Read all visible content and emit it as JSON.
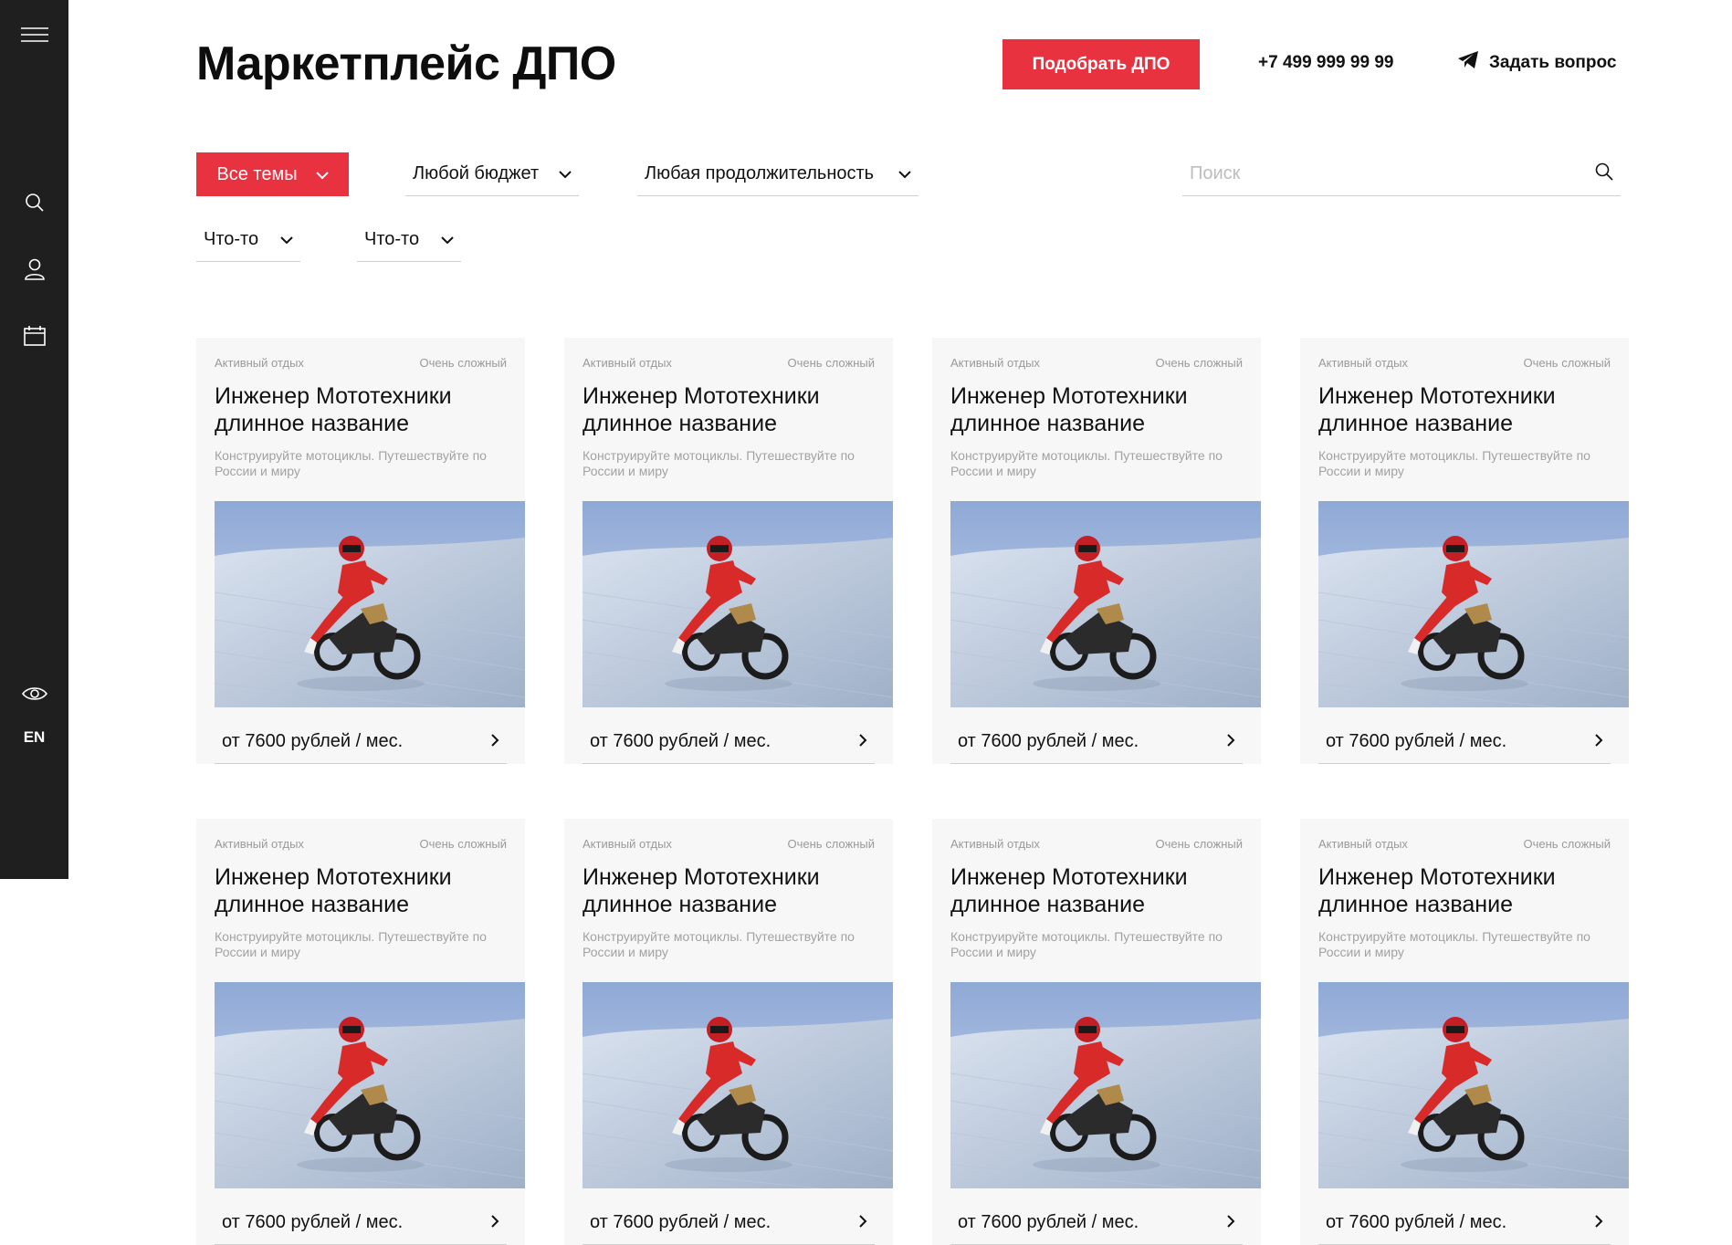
{
  "sidebar": {
    "menu_icon": "hamburger-menu-icon",
    "search_icon": "search-icon",
    "user_icon": "user-icon",
    "calendar_icon": "calendar-icon",
    "eye_icon": "eye-icon",
    "lang": "EN"
  },
  "header": {
    "title": "Маркетплейс ДПО",
    "pick_button": "Подобрать ДПО",
    "phone": "+7 499 999 99 99",
    "ask": "Задать вопрос",
    "ask_icon": "telegram-icon"
  },
  "filters": {
    "topics": "Все темы",
    "budget": "Любой бюджет",
    "duration": "Любая продолжительность",
    "extra1": "Что-то",
    "extra2": "Что-то",
    "search_placeholder": "Поиск"
  },
  "cards": [
    {
      "category": "Активный отдых",
      "difficulty": "Очень сложный",
      "title_line1": "Инженер Мототехники",
      "title_line2": "длинное название",
      "desc": "Конструируйте мотоциклы. Путешествуйте по России и миру",
      "price": "от 7600 рублей / мес."
    },
    {
      "category": "Активный отдых",
      "difficulty": "Очень сложный",
      "title_line1": "Инженер Мототехники",
      "title_line2": "длинное название",
      "desc": "Конструируйте мотоциклы. Путешествуйте по России и миру",
      "price": "от 7600 рублей / мес."
    },
    {
      "category": "Активный отдых",
      "difficulty": "Очень сложный",
      "title_line1": "Инженер Мототехники",
      "title_line2": "длинное название",
      "desc": "Конструируйте мотоциклы. Путешествуйте по России и миру",
      "price": "от 7600 рублей / мес."
    },
    {
      "category": "Активный отдых",
      "difficulty": "Очень сложный",
      "title_line1": "Инженер Мототехники",
      "title_line2": "длинное название",
      "desc": "Конструируйте мотоциклы. Путешествуйте по России и миру",
      "price": "от 7600 рублей / мес."
    },
    {
      "category": "Активный отдых",
      "difficulty": "Очень сложный",
      "title_line1": "Инженер Мототехники",
      "title_line2": "длинное название",
      "desc": "Конструируйте мотоциклы. Путешествуйте по России и миру",
      "price": "от 7600 рублей / мес."
    },
    {
      "category": "Активный отдых",
      "difficulty": "Очень сложный",
      "title_line1": "Инженер Мототехники",
      "title_line2": "длинное название",
      "desc": "Конструируйте мотоциклы. Путешествуйте по России и миру",
      "price": "от 7600 рублей / мес."
    },
    {
      "category": "Активный отдых",
      "difficulty": "Очень сложный",
      "title_line1": "Инженер Мототехники",
      "title_line2": "длинное название",
      "desc": "Конструируйте мотоциклы. Путешествуйте по России и миру",
      "price": "от 7600 рублей / мес."
    },
    {
      "category": "Активный отдых",
      "difficulty": "Очень сложный",
      "title_line1": "Инженер Мототехники",
      "title_line2": "длинное название",
      "desc": "Конструируйте мотоциклы. Путешествуйте по России и миру",
      "price": "от 7600 рублей / мес."
    }
  ],
  "colors": {
    "accent": "#e8323f",
    "sidebar": "#1f1f1f",
    "card_bg": "#f7f7f7"
  }
}
